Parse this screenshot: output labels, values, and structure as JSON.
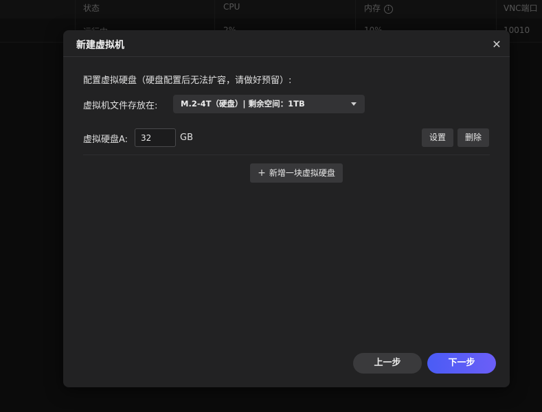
{
  "background_table": {
    "headers": [
      "状态",
      "CPU",
      "内存",
      "VNC端口"
    ],
    "row": [
      "运行中",
      "2%",
      "10%",
      "10010"
    ],
    "memory_info_icon": "info-icon"
  },
  "dialog": {
    "title": "新建虚拟机",
    "close_icon": "close-icon",
    "section_title": "配置虚拟硬盘（硬盘配置后无法扩容，请做好预留）:",
    "storage_location": {
      "label": "虚拟机文件存放在:",
      "selected": "M.2-4T（硬盘）| 剩余空间：1TB"
    },
    "disk": {
      "label": "虚拟硬盘A:",
      "value": "32",
      "unit": "GB",
      "settings_label": "设置",
      "delete_label": "删除"
    },
    "add_disk_label": "新增一块虚拟硬盘",
    "add_icon": "plus-icon",
    "prev_label": "上一步",
    "next_label": "下一步",
    "accent_color": "#5b5ef6"
  }
}
